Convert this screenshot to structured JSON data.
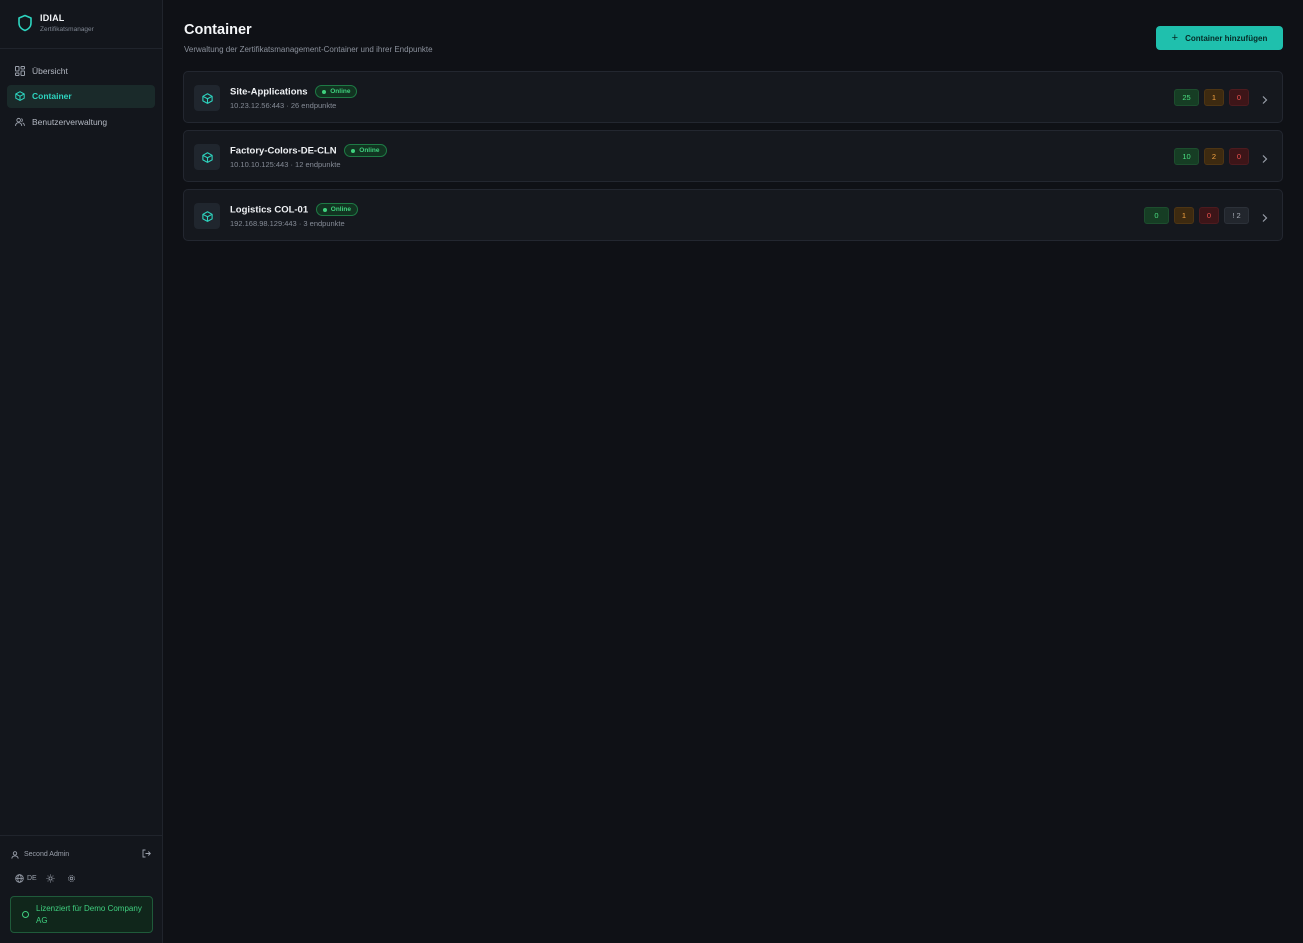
{
  "brand": {
    "name": "IDIAL",
    "subtitle": "Zertifikatsmanager"
  },
  "nav": [
    {
      "label": "Übersicht",
      "icon": "grid-icon",
      "active": false
    },
    {
      "label": "Container",
      "icon": "box-icon",
      "active": true
    },
    {
      "label": "Benutzerverwaltung",
      "icon": "users-icon",
      "active": false
    }
  ],
  "user": {
    "name": "Second Admin"
  },
  "utils": {
    "language": "DE"
  },
  "license": {
    "text": "Lizenziert für Demo Company AG"
  },
  "page": {
    "title": "Container",
    "subtitle": "Verwaltung der Zertifikatsmanagement-Container und ihrer Endpunkte",
    "add_button": "Container hinzufügen"
  },
  "containers": [
    {
      "name": "Site-Applications",
      "status": "Online",
      "meta": "10.23.12.56:443 · 26 endpunkte",
      "counts": {
        "green": "25",
        "orange": "1",
        "red": "0"
      }
    },
    {
      "name": "Factory-Colors-DE-CLN",
      "status": "Online",
      "meta": "10.10.10.125:443 · 12 endpunkte",
      "counts": {
        "green": "10",
        "orange": "2",
        "red": "0"
      }
    },
    {
      "name": "Logistics COL-01",
      "status": "Online",
      "meta": "192.168.98.129:443 · 3 endpunkte",
      "counts": {
        "green": "0",
        "orange": "1",
        "red": "0",
        "gray": "! 2"
      }
    }
  ],
  "colors": {
    "accent": "#2dd4bf",
    "background": "#0f1116",
    "sidebar": "#13161c",
    "online": "#3fd17e"
  }
}
